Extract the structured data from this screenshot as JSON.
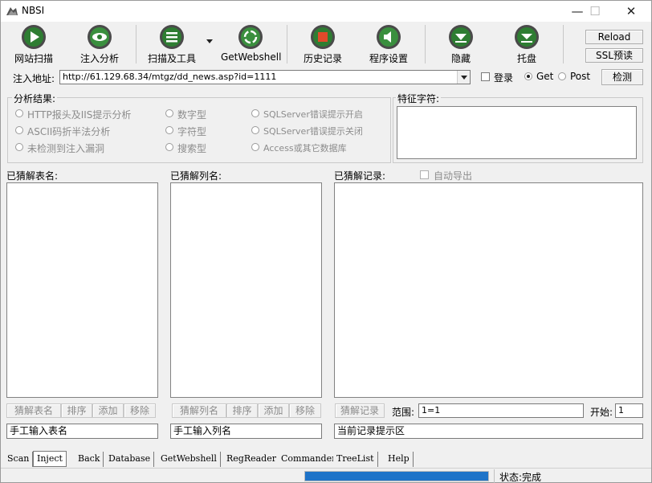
{
  "window": {
    "title": "NBSI",
    "controls": [
      "—",
      "☐",
      "✕"
    ]
  },
  "toolbar": {
    "scan_label": "网站扫描",
    "inject_label": "注入分析",
    "scan_tools_label": "扫描及工具",
    "getwebshell_label": "GetWebshell",
    "history_label": "历史记录",
    "settings_label": "程序设置",
    "hide_label": "隐藏",
    "tray_label": "托盘",
    "reload_label": "Reload",
    "ssl_label": "SSL预读"
  },
  "address": {
    "label": "注入地址:",
    "value": "http://61.129.68.34/mtgz/dd_news.asp?id=1111",
    "login_label": "登录",
    "get_label": "Get",
    "post_label": "Post",
    "detect_label": "检测"
  },
  "analysis": {
    "title": "分析结果:",
    "options": [
      "HTTP报头及IIS提示分析",
      "ASCII码折半法分析",
      "未检测到注入漏洞"
    ],
    "types": [
      "数字型",
      "字符型",
      "搜索型"
    ],
    "db": [
      "SQLServer错误提示开启",
      "SQLServer错误提示关闭",
      "Access或其它数据库"
    ],
    "feature_title": "特征字符:"
  },
  "tables": {
    "label": "已猜解表名:",
    "buttons": [
      "猜解表名",
      "排序",
      "添加",
      "移除"
    ],
    "input_placeholder": "手工输入表名"
  },
  "columns": {
    "label": "已猜解列名:",
    "buttons": [
      "猜解列名",
      "排序",
      "添加",
      "移除"
    ],
    "input_placeholder": "手工输入列名"
  },
  "records": {
    "label": "已猜解记录:",
    "auto_export_label": "自动导出",
    "guess_button": "猜解记录",
    "range_label": "范围:",
    "range_value": "1=1",
    "start_label": "开始:",
    "start_value": "1",
    "hint": "当前记录提示区"
  },
  "tabs": [
    "Scan",
    "Inject",
    "Back",
    "Database",
    "GetWebshell",
    "RegReader",
    "Commander",
    "TreeList",
    "Help"
  ],
  "status": {
    "text": "状态:完成",
    "progress": 1.0
  },
  "colors": {
    "progress": "#1e73c8",
    "accent": "#2e7d32"
  }
}
